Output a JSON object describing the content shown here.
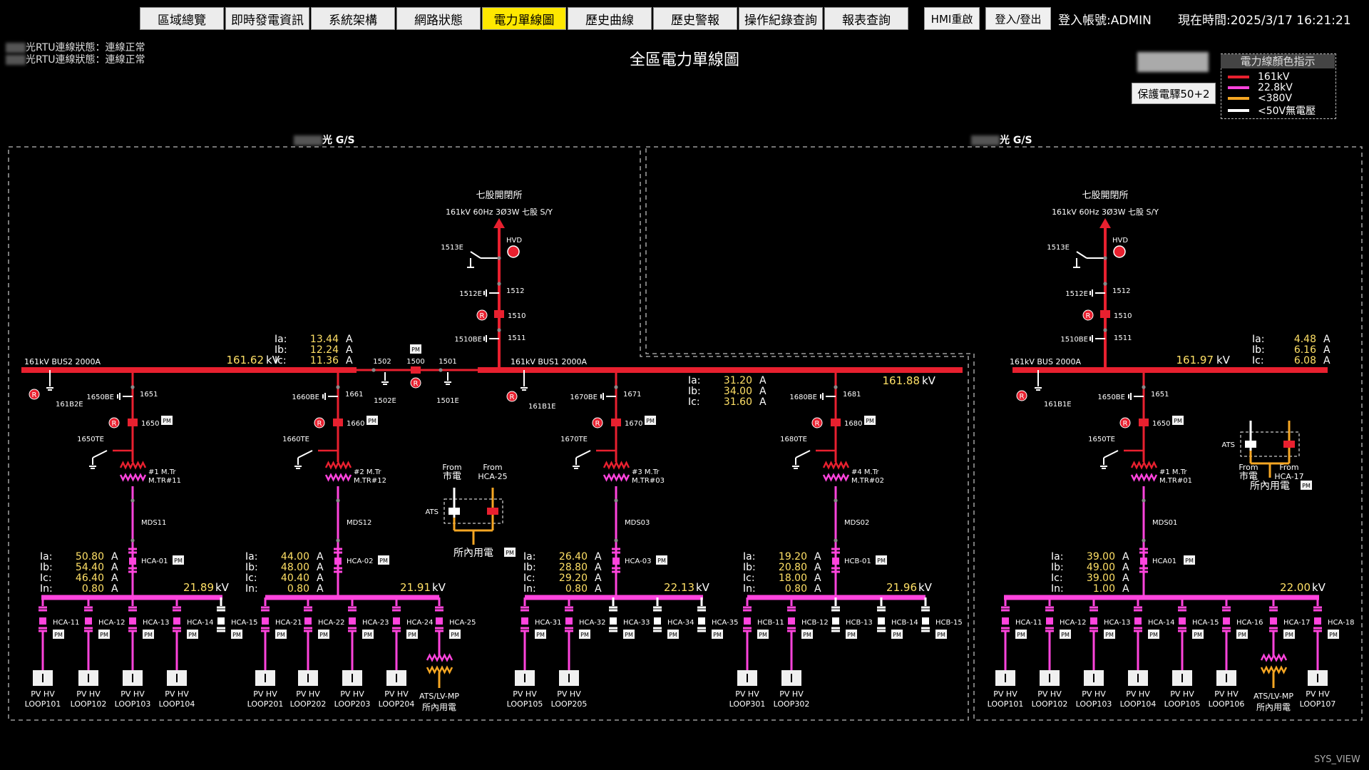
{
  "nav": [
    "區域總覽",
    "即時發電資訊",
    "系統架構",
    "網路狀態",
    "電力單線圖",
    "歷史曲線",
    "歷史警報",
    "操作紀錄查詢",
    "報表查詢"
  ],
  "header": {
    "hmi_restart": "HMI重啟",
    "login_logout": "登入/登出",
    "account_label": "登入帳號",
    "account_value": ":ADMIN",
    "time_label": "現在時間",
    "time_value": ":2025/3/17  16:21:21"
  },
  "status": [
    {
      "prefix": "光RTU連線狀態：",
      "value": "連線正常"
    },
    {
      "prefix": "光RTU連線狀態：",
      "value": "連線正常"
    }
  ],
  "page_title": "全區電力單線圖",
  "protect_button": "保護電驛50+2",
  "legend": {
    "title": "電力線顏色指示",
    "items": [
      {
        "label": "161kV",
        "color": "#e8202f"
      },
      {
        "label": "22.8kV",
        "color": "#ff44dd"
      },
      {
        "label": "<380V",
        "color": "#f5a623"
      },
      {
        "label": "<50V無電壓",
        "color": "#ffffff"
      }
    ]
  },
  "gs_labels": [
    "光 G/S",
    "光 G/S"
  ],
  "footer": "SYS_VIEW",
  "colors": {
    "hv": "#e8202f",
    "mv": "#ff44dd",
    "lv": "#f5a623",
    "value": "#ffe066",
    "breaker": "#ff44dd"
  },
  "diagram": {
    "left": {
      "source_name": "七股開閉所",
      "source_desc": "161kV 60Hz 3Ø3W 七股 S/Y",
      "hvd": "HVD",
      "bus2": {
        "name": "161kV BUS2 2000A",
        "kv": "161.62",
        "unit": "kV",
        "ia": "13.44",
        "ib": "12.24",
        "ic": "11.36"
      },
      "bus1": {
        "name": "161kV BUS1 2000A",
        "kv": "161.88",
        "unit": "kV",
        "ia": "31.20",
        "ib": "34.00",
        "ic": "31.60"
      },
      "switch_labels": [
        "1513E",
        "1512E",
        "1512",
        "1510",
        "1510BE",
        "1511",
        "1502",
        "1500",
        "1501",
        "1502E",
        "1501E"
      ],
      "feeders": [
        {
          "ds": "1650BE",
          "sw": "1651",
          "cb": "1650",
          "te": "1650TE",
          "gnd": "161B2E",
          "tr": "#1 M.Tr",
          "trn": "M.TR#11",
          "mds": "MDS11",
          "hc": "HCA-01",
          "ia": "50.80",
          "ib": "54.40",
          "ic": "46.40",
          "in": "0.80",
          "kv": "21.89",
          "branches": [
            "HCA-11",
            "HCA-12",
            "HCA-13",
            "HCA-14",
            "HCA-15"
          ],
          "loads": [
            {
              "a": "PV HV",
              "b": "LOOP101"
            },
            {
              "a": "PV HV",
              "b": "LOOP102"
            },
            {
              "a": "PV HV",
              "b": "LOOP103"
            },
            {
              "a": "PV HV",
              "b": "LOOP104"
            }
          ]
        },
        {
          "ds": "1660BE",
          "sw": "1661",
          "cb": "1660",
          "te": "1660TE",
          "gnd": "",
          "tr": "#2 M.Tr",
          "trn": "M.TR#12",
          "mds": "MDS12",
          "hc": "HCA-02",
          "ia": "44.00",
          "ib": "48.00",
          "ic": "40.40",
          "in": "0.80",
          "kv": "21.91",
          "branches": [
            "HCA-21",
            "HCA-22",
            "HCA-23",
            "HCA-24",
            "HCA-25"
          ],
          "loads": [
            {
              "a": "PV HV",
              "b": "LOOP201"
            },
            {
              "a": "PV HV",
              "b": "LOOP202"
            },
            {
              "a": "PV HV",
              "b": "LOOP203"
            },
            {
              "a": "PV HV",
              "b": "LOOP204"
            },
            {
              "a": "ATS/LV-MP",
              "b": "所內用電"
            }
          ]
        },
        {
          "ds": "1670BE",
          "sw": "1671",
          "cb": "1670",
          "te": "1670TE",
          "gnd": "161B1E",
          "tr": "#3 M.Tr",
          "trn": "M.TR#03",
          "mds": "MDS03",
          "hc": "HCA-03",
          "ia": "26.40",
          "ib": "28.80",
          "ic": "29.20",
          "in": "0.80",
          "kv": "22.13",
          "branches": [
            "HCA-31",
            "HCA-32",
            "HCA-33",
            "HCA-34",
            "HCA-35"
          ],
          "loads": [
            {
              "a": "PV HV",
              "b": "LOOP105"
            },
            {
              "a": "PV HV",
              "b": "LOOP205"
            }
          ]
        },
        {
          "ds": "1680BE",
          "sw": "1681",
          "cb": "1680",
          "te": "1680TE",
          "gnd": "",
          "tr": "#4 M.Tr",
          "trn": "M.TR#02",
          "mds": "MDS02",
          "hc": "HCB-01",
          "ia": "19.20",
          "ib": "20.80",
          "ic": "18.00",
          "in": "0.80",
          "kv": "21.96",
          "branches": [
            "HCB-11",
            "HCB-12",
            "HCB-13",
            "HCB-14",
            "HCB-15"
          ],
          "loads": [
            {
              "a": "PV HV",
              "b": "LOOP301"
            },
            {
              "a": "PV HV",
              "b": "LOOP302"
            }
          ]
        }
      ],
      "ats": {
        "from1": "From",
        "from1b": "市電",
        "from2": "From",
        "from2b": "HCA-25",
        "label": "ATS",
        "use": "所內用電"
      }
    },
    "right": {
      "source_name": "七股開閉所",
      "source_desc": "161kV 60Hz 3Ø3W 七股 S/Y",
      "hvd": "HVD",
      "bus": {
        "name": "161kV BUS 2000A",
        "kv": "161.97",
        "unit": "kV",
        "ia": "4.48",
        "ib": "6.16",
        "ic": "6.08"
      },
      "switch_labels": [
        "1513E",
        "1512E",
        "1512",
        "1510",
        "1510BE",
        "1511"
      ],
      "feeder": {
        "ds": "1650BE",
        "sw": "1651",
        "cb": "1650",
        "te": "1650TE",
        "gnd": "161B1E",
        "tr": "#1 M.Tr",
        "trn": "M.TR#01",
        "mds": "MDS01",
        "hc": "HCA01",
        "ia": "39.00",
        "ib": "49.00",
        "ic": "39.00",
        "in": "1.00",
        "kv": "22.00",
        "branches": [
          "HCA-11",
          "HCA-12",
          "HCA-13",
          "HCA-14",
          "HCA-15",
          "HCA-16",
          "HCA-17",
          "HCA-18"
        ],
        "loads": [
          {
            "a": "PV HV",
            "b": "LOOP101"
          },
          {
            "a": "PV HV",
            "b": "LOOP102"
          },
          {
            "a": "PV HV",
            "b": "LOOP103"
          },
          {
            "a": "PV HV",
            "b": "LOOP104"
          },
          {
            "a": "PV HV",
            "b": "LOOP105"
          },
          {
            "a": "PV HV",
            "b": "LOOP106"
          },
          {
            "a": "ATS/LV-MP",
            "b": "所內用電"
          },
          {
            "a": "PV HV",
            "b": "LOOP107"
          }
        ]
      },
      "ats": {
        "from1": "From",
        "from1b": "市電",
        "from2": "From",
        "from2b": "HCA-17",
        "label": "ATS",
        "use": "所內用電"
      }
    },
    "pm": "PM",
    "r": "R",
    "cur": {
      "ia": "Ia:",
      "ib": "Ib:",
      "ic": "Ic:",
      "in": "In:",
      "unit": "A"
    }
  }
}
